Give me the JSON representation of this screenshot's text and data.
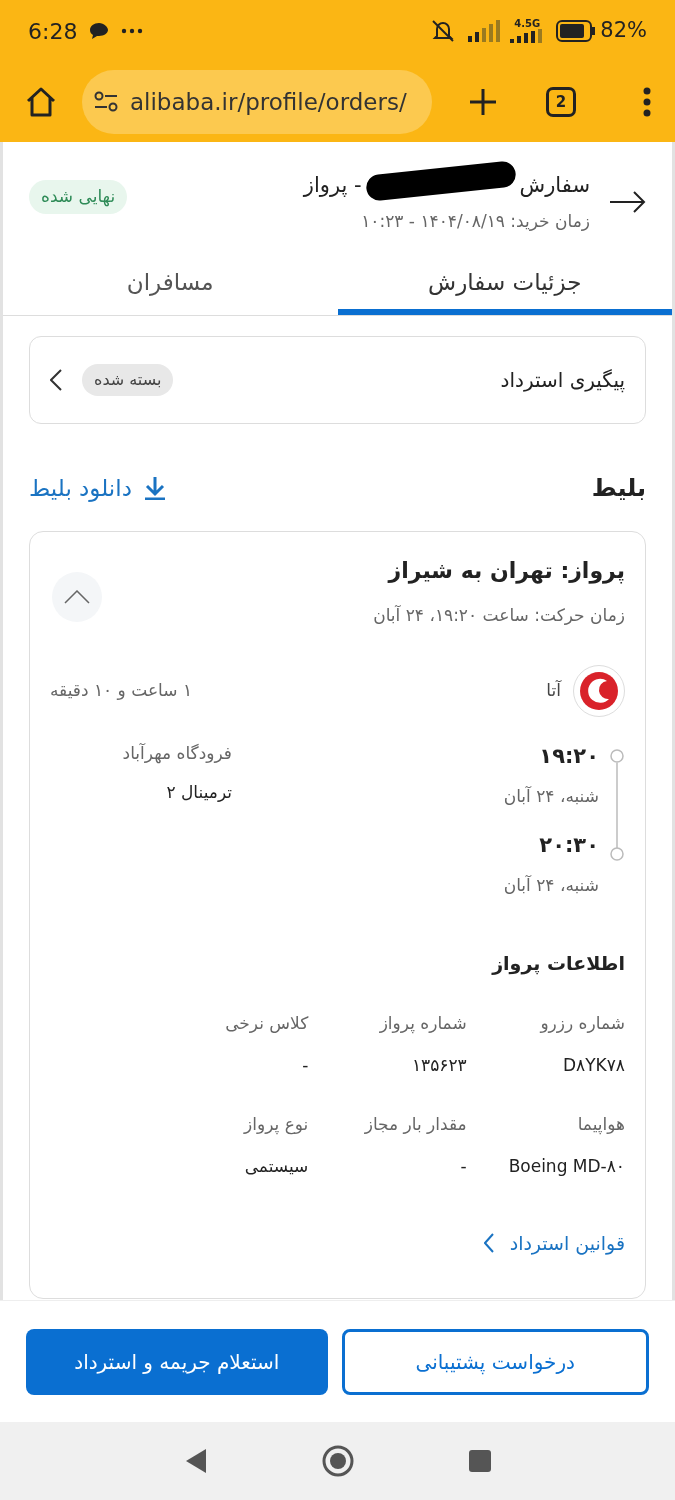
{
  "status_bar": {
    "time": "6:28",
    "network": "4.5G",
    "battery": "82%"
  },
  "browser": {
    "url": "alibaba.ir/profile/orders/",
    "tab_count": "2"
  },
  "order": {
    "title_start": "سفارش",
    "title_end": "- پرواز",
    "purchase_time": "زمان خرید: ۱۴۰۴/۰۸/۱۹ - ۱۰:۲۳",
    "status": "نهایی شده"
  },
  "tabs": [
    {
      "label": "جزئیات سفارش",
      "selected": true
    },
    {
      "label": "مسافران",
      "selected": false
    }
  ],
  "refund_tracking": {
    "label": "پیگیری استرداد",
    "status": "بسته شده"
  },
  "ticket": {
    "heading": "بلیط",
    "download": "دانلود بلیط",
    "flight": {
      "title": "پرواز: تهران به شیراز",
      "departure": "زمان حرکت: ساعت ۱۹:۲۰، ۲۴ آبان",
      "expanded": true,
      "airline": "آتا",
      "duration": "۱ ساعت و ۱۰ دقیقه",
      "stops": [
        {
          "time": "۱۹:۲۰",
          "date": "شنبه، ۲۴ آبان",
          "place": "فرودگاه مهرآباد",
          "terminal": "ترمینال ۲"
        },
        {
          "time": "۲۰:۳۰",
          "date": "شنبه، ۲۴ آبان"
        }
      ]
    },
    "info": {
      "heading": "اطلاعات پرواز",
      "fields": [
        {
          "label": "شماره رزرو",
          "value": "D۸YK۷۸"
        },
        {
          "label": "شماره پرواز",
          "value": "۱۳۵۶۲۳"
        },
        {
          "label": "کلاس نرخی",
          "value": "-"
        },
        {
          "label": "هواپیما",
          "value": "Boeing MD-۸۰"
        },
        {
          "label": "مقدار بار مجاز",
          "value": "-"
        },
        {
          "label": "نوع پرواز",
          "value": "سیستمی"
        }
      ]
    },
    "refund_rules": "قوانین استرداد"
  },
  "buttons": [
    {
      "label": "درخواست پشتیبانی",
      "kind": "outline"
    },
    {
      "label": "استعلام جریمه و استرداد",
      "kind": "filled"
    }
  ]
}
